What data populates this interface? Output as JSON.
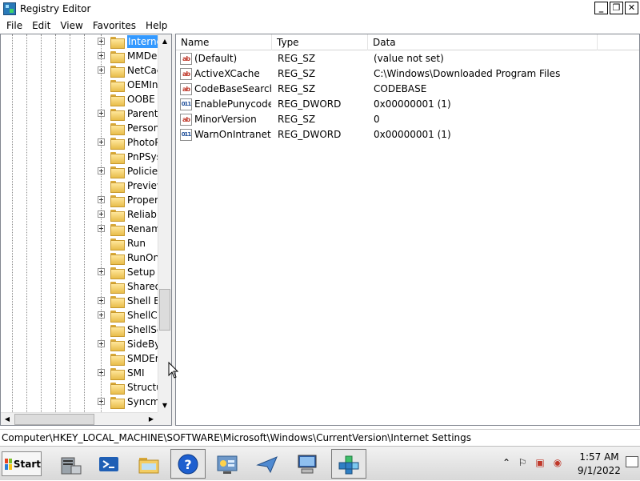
{
  "window": {
    "title": "Registry Editor",
    "minimize": "_",
    "restore": "❐",
    "close": "✕"
  },
  "menu": [
    "File",
    "Edit",
    "View",
    "Favorites",
    "Help"
  ],
  "tree": {
    "selected": "Internet Settings",
    "items": [
      {
        "label": "Interne",
        "expander": true,
        "selected": true
      },
      {
        "label": "MMDe",
        "expander": true
      },
      {
        "label": "NetCac",
        "expander": true
      },
      {
        "label": "OEMIn",
        "expander": false
      },
      {
        "label": "OOBE",
        "expander": false
      },
      {
        "label": "Parenta",
        "expander": true
      },
      {
        "label": "Person",
        "expander": false
      },
      {
        "label": "PhotoP",
        "expander": true
      },
      {
        "label": "PnPSys",
        "expander": false
      },
      {
        "label": "Policie",
        "expander": true
      },
      {
        "label": "Preview",
        "expander": false
      },
      {
        "label": "Proper",
        "expander": true
      },
      {
        "label": "Reliabi",
        "expander": true
      },
      {
        "label": "Renam",
        "expander": true
      },
      {
        "label": "Run",
        "expander": false
      },
      {
        "label": "RunOn",
        "expander": false
      },
      {
        "label": "Setup",
        "expander": true
      },
      {
        "label": "Shared",
        "expander": false
      },
      {
        "label": "Shell Ex",
        "expander": true
      },
      {
        "label": "ShellCo",
        "expander": true
      },
      {
        "label": "ShellSe",
        "expander": false
      },
      {
        "label": "SideBy",
        "expander": true
      },
      {
        "label": "SMDEr",
        "expander": false
      },
      {
        "label": "SMI",
        "expander": true
      },
      {
        "label": "Structu",
        "expander": false
      },
      {
        "label": "Syncm",
        "expander": true
      }
    ]
  },
  "list": {
    "columns": [
      "Name",
      "Type",
      "Data"
    ],
    "rows": [
      {
        "name": "(Default)",
        "type": "REG_SZ",
        "data": "(value not set)",
        "icon": "string-value-icon",
        "icon_text": "ab"
      },
      {
        "name": "ActiveXCache",
        "type": "REG_SZ",
        "data": "C:\\Windows\\Downloaded Program Files",
        "icon": "string-value-icon",
        "icon_text": "ab"
      },
      {
        "name": "CodeBaseSearch...",
        "type": "REG_SZ",
        "data": "CODEBASE",
        "icon": "string-value-icon",
        "icon_text": "ab"
      },
      {
        "name": "EnablePunycode",
        "type": "REG_DWORD",
        "data": "0x00000001 (1)",
        "icon": "binary-value-icon",
        "icon_text": "011"
      },
      {
        "name": "MinorVersion",
        "type": "REG_SZ",
        "data": "0",
        "icon": "string-value-icon",
        "icon_text": "ab"
      },
      {
        "name": "WarnOnIntranet",
        "type": "REG_DWORD",
        "data": "0x00000001 (1)",
        "icon": "binary-value-icon",
        "icon_text": "011"
      }
    ]
  },
  "status": {
    "path": "Computer\\HKEY_LOCAL_MACHINE\\SOFTWARE\\Microsoft\\Windows\\CurrentVersion\\Internet Settings"
  },
  "taskbar": {
    "start_label": "Start",
    "apps": [
      {
        "icon": "server-manager-icon",
        "active": false
      },
      {
        "icon": "powershell-icon",
        "active": false
      },
      {
        "icon": "file-explorer-icon",
        "active": false
      },
      {
        "icon": "help-icon",
        "active": true
      },
      {
        "icon": "control-panel-icon",
        "active": false
      },
      {
        "icon": "send-icon",
        "active": false
      },
      {
        "icon": "remote-desktop-icon",
        "active": false
      },
      {
        "icon": "registry-editor-icon",
        "active": true
      }
    ],
    "clock_time": "1:57 AM",
    "clock_date": "9/1/2022"
  },
  "colors": {
    "selection": "#3399ff",
    "pane_border": "#828790",
    "folder": "#e8bd4a"
  }
}
